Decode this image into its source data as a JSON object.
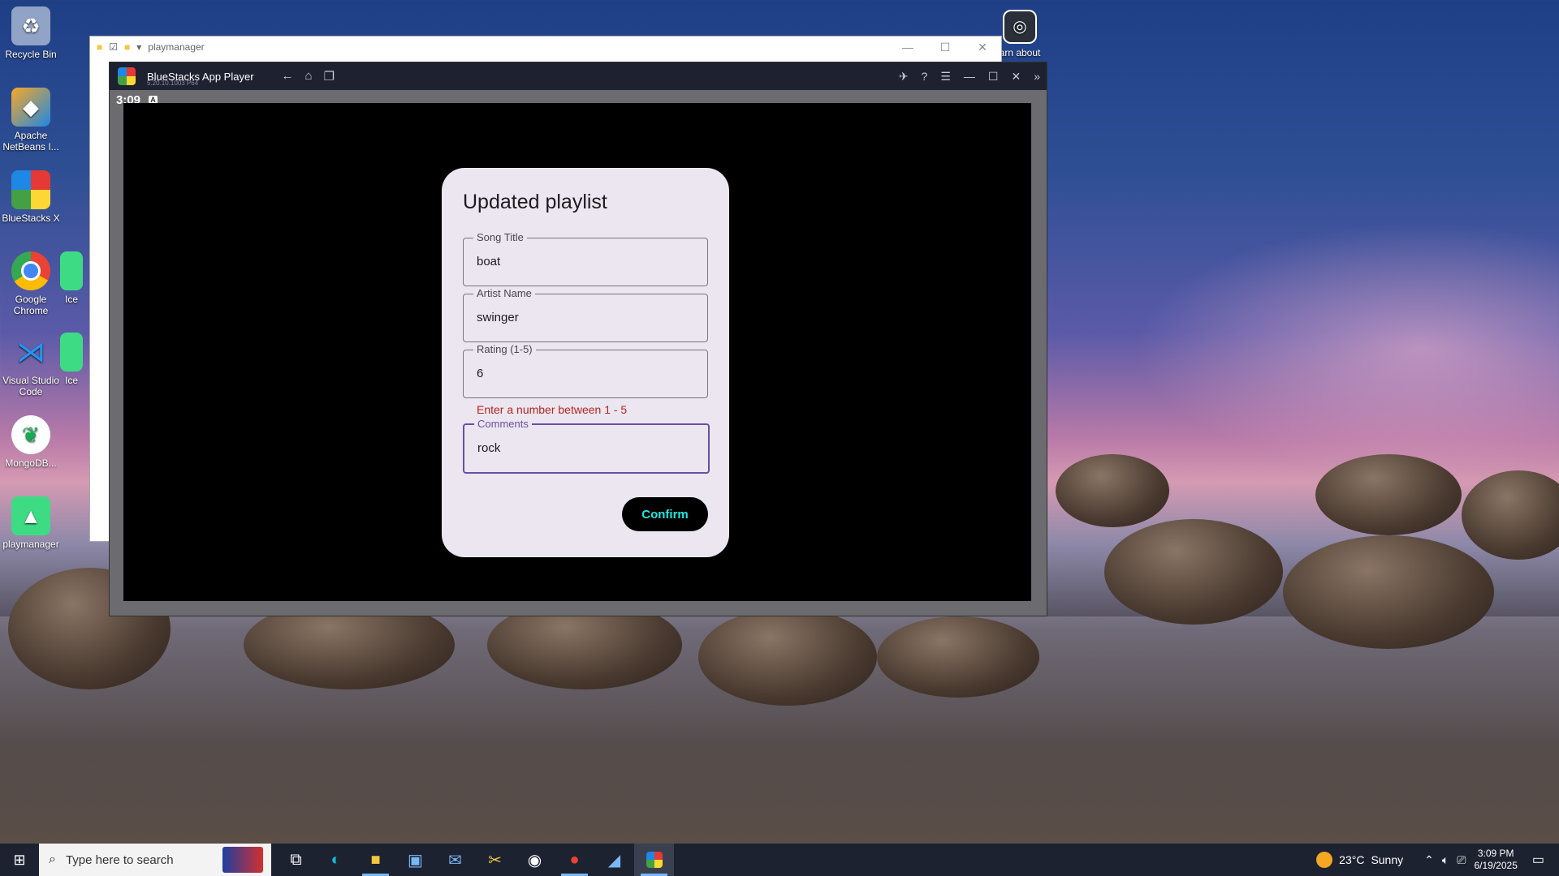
{
  "desktop": {
    "icons": [
      {
        "label": "Recycle Bin",
        "icon": "recycle-bin-icon"
      },
      {
        "label": "Apache NetBeans I...",
        "icon": "netbeans-icon"
      },
      {
        "label": "BlueStacks X",
        "icon": "bluestacks-icon"
      },
      {
        "label": "Google Chrome",
        "icon": "chrome-icon"
      },
      {
        "label": "Visual Studio Code",
        "icon": "vscode-icon"
      },
      {
        "label": "MongoDB...",
        "icon": "mongodb-icon"
      },
      {
        "label": "playmanager",
        "icon": "android-icon"
      },
      {
        "label": "Ice",
        "icon": "android-icon"
      },
      {
        "label": "Ice",
        "icon": "android-icon"
      }
    ],
    "learn_about": "arn about"
  },
  "explorer": {
    "title": "playmanager"
  },
  "bluestacks": {
    "title": "BlueStacks App Player",
    "version": "5.20.10.1003 P64",
    "status_time": "3:09",
    "status_icon": "A"
  },
  "dialog": {
    "title": "Updated playlist",
    "fields": [
      {
        "label": "Song Title",
        "value": "boat"
      },
      {
        "label": "Artist Name",
        "value": "swinger"
      },
      {
        "label": "Rating (1-5)",
        "value": "6"
      },
      {
        "label": "Comments",
        "value": "rock"
      }
    ],
    "error": "Enter a number between 1 - 5",
    "confirm_label": "Confirm"
  },
  "taskbar": {
    "search_placeholder": "Type here to search",
    "weather_temp": "23°C",
    "weather_desc": "Sunny",
    "time": "3:09 PM",
    "date": "6/19/2025"
  },
  "colors": {
    "accent": "#6750a4",
    "error": "#b3261e",
    "confirm_text": "#1de9e0"
  }
}
